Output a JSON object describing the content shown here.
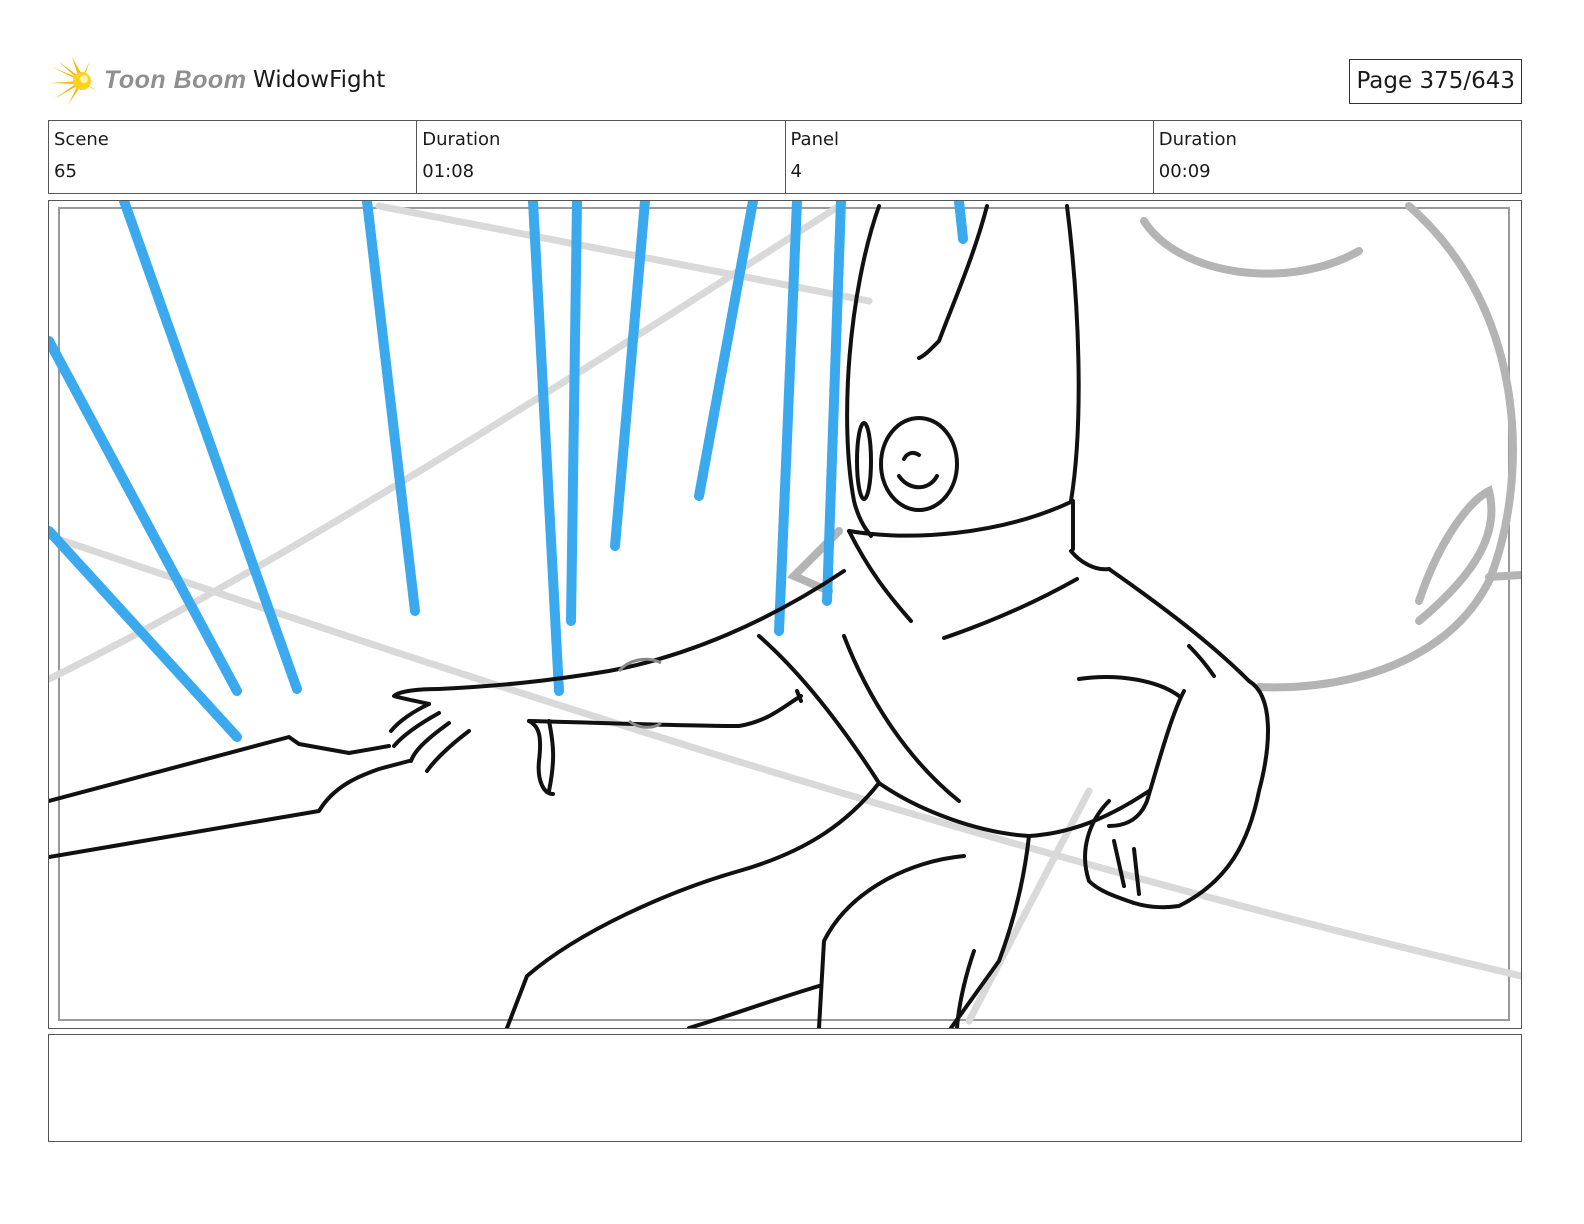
{
  "header": {
    "logo_text": "Toon Boom",
    "project_title": "WidowFight",
    "page_label": "Page 375/643"
  },
  "info": {
    "scene_label": "Scene",
    "scene_value": "65",
    "scene_duration_label": "Duration",
    "scene_duration_value": "01:08",
    "panel_label": "Panel",
    "panel_value": "4",
    "panel_duration_label": "Duration",
    "panel_duration_value": "00:09"
  },
  "notes": {
    "text": ""
  },
  "colors": {
    "logo_star": "#f5b800",
    "logo_text": "#8f8f8f",
    "speed_lines": "#3aa9ee",
    "ink": "#111111",
    "pencil_gray": "#b4b4b4",
    "border": "#555555"
  }
}
